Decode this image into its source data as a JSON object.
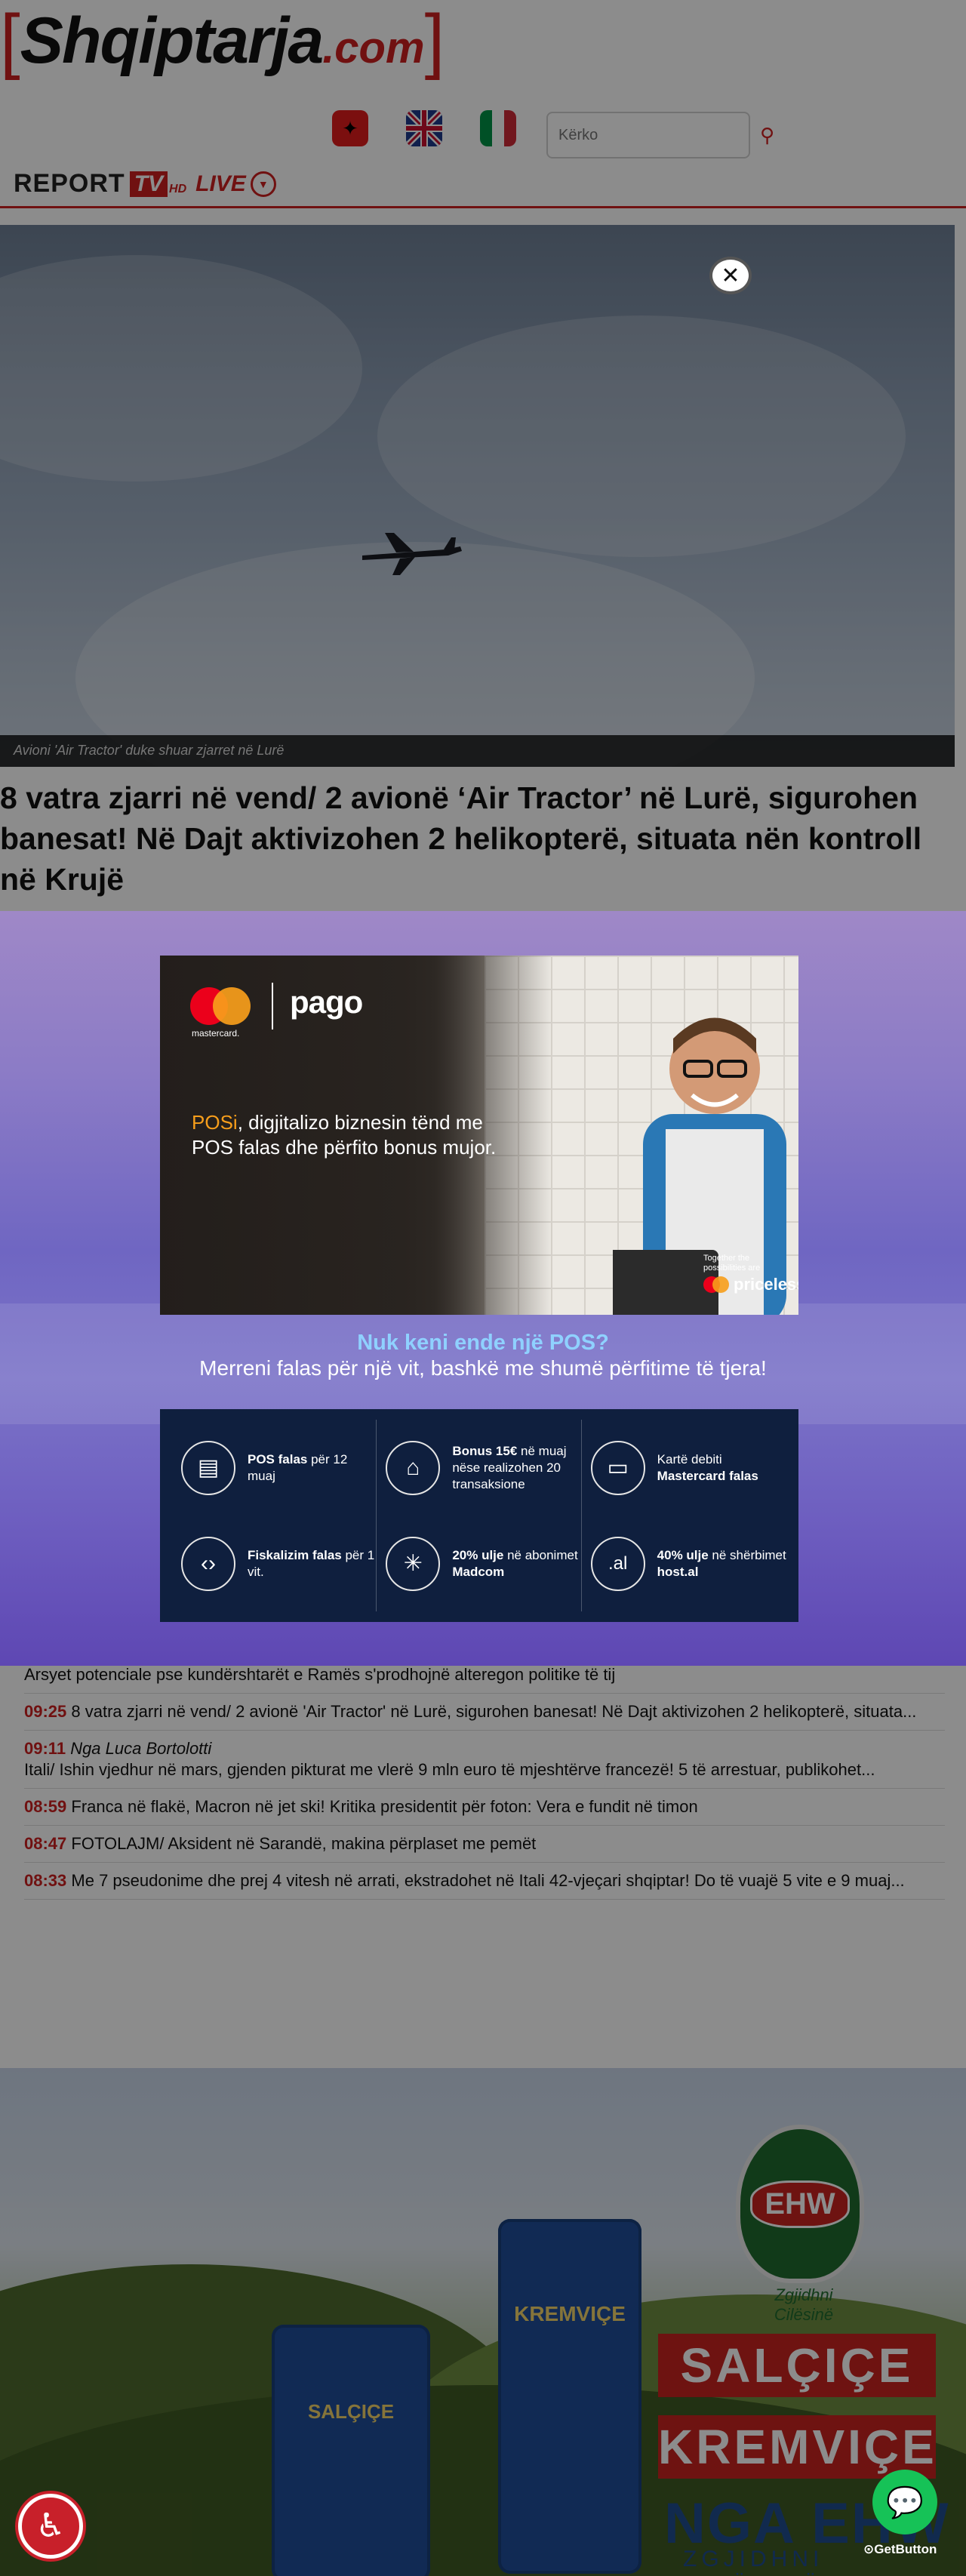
{
  "site": {
    "logo_bracket_left": "[",
    "logo_name": "Shqiptarja",
    "logo_dotcom": ".com",
    "logo_bracket_right": "]"
  },
  "search": {
    "placeholder": "Kërko"
  },
  "report_tv": {
    "report": "REPORT",
    "tv": "TV",
    "hd": "HD",
    "live": "LIVE"
  },
  "hero": {
    "caption": "Avioni 'Air Tractor' duke shuar zjarret në Lurë",
    "close": "✕"
  },
  "article": {
    "headline": "8 vatra zjarri në vend/ 2 avionë ‘Air Tractor’ në Lurë, sigurohen banesat! Në Dajt aktivizohen 2 helikopterë, situata nën kontroll në Krujë"
  },
  "modal": {
    "brand_mc": "mastercard.",
    "brand_pago": "pago",
    "promo_hl": "POSi",
    "promo_text": ", digjitalizo biznesin tënd me POS falas dhe përfito bonus mujor.",
    "priceless_small": "Together the possibilities are",
    "priceless": "priceless",
    "question": "Nuk keni ende një POS?",
    "subtitle": "Merreni falas për një vit, bashkë me shumë përfitime të tjera!",
    "benefits": [
      {
        "strong": "POS falas",
        "rest": " për 12 muaj",
        "icon": "pos-terminal-icon",
        "glyph": "▤"
      },
      {
        "strong": "Bonus 15€",
        "rest": " në muaj nëse realizohen 20 transaksione",
        "icon": "gift-icon",
        "glyph": "⌂"
      },
      {
        "strong": "Mastercard falas",
        "pre": "Kartë debiti ",
        "icon": "card-icon",
        "glyph": "▭"
      },
      {
        "strong": "Fiskalizim falas",
        "rest": " për 1 vit.",
        "icon": "code-icon",
        "glyph": "‹›"
      },
      {
        "strong": "20% ulje",
        "rest": " në abonimet ",
        "strong2": "Madcom",
        "icon": "asterisk-icon",
        "glyph": "✳"
      },
      {
        "strong": "40% ulje",
        "rest": " në shërbimet ",
        "strong2": "host.al",
        "icon": "domain-icon",
        "glyph": ".al"
      }
    ]
  },
  "news": [
    {
      "time": "",
      "author": "",
      "text": "Arsyet potenciale pse kundërshtarët e Ramës s'prodhojnë alteregon politike të tij"
    },
    {
      "time": "09:25",
      "author": "",
      "text": "8 vatra zjarri në vend/ 2 avionë 'Air Tractor' në Lurë, sigurohen banesat! Në Dajt aktivizohen 2 helikopterë, situata..."
    },
    {
      "time": "09:11",
      "author": "Nga Luca Bortolotti",
      "text": "Itali/ Ishin vjedhur në mars, gjenden pikturat me vlerë 9 mln euro të mjeshtërve francezë! 5 të arrestuar, publikohet..."
    },
    {
      "time": "08:59",
      "author": "",
      "text": "Franca në flakë, Macron në jet ski! Kritika presidentit për foton: Vera e fundit në timon"
    },
    {
      "time": "08:47",
      "author": "",
      "text": "FOTOLAJM/ Aksident në Sarandë, makina përplaset me pemët"
    },
    {
      "time": "08:33",
      "author": "",
      "text": "Me 7 pseudonime dhe prej 4 vitesh në arrati, ekstradohet në Itali 42-vjeçari shqiptar! Do të vuajë 5 vite e 9 muaj..."
    }
  ],
  "banner": {
    "logo": "EHW",
    "logo_sub": "Zgjidhni Cilësinë",
    "line1": "SALÇIÇE",
    "line2": "KREMVIÇE",
    "line3": "NGA EHW",
    "line4": "ZGJIDHNI CILËSINË",
    "pack1": "SALÇIÇE",
    "pack2": "KREMVIÇE"
  },
  "widgets": {
    "getbutton": "GetButton"
  },
  "colors": {
    "brand_red": "#cc1f1f",
    "pago_navy": "#0f1f3e",
    "whatsapp": "#16c257"
  }
}
